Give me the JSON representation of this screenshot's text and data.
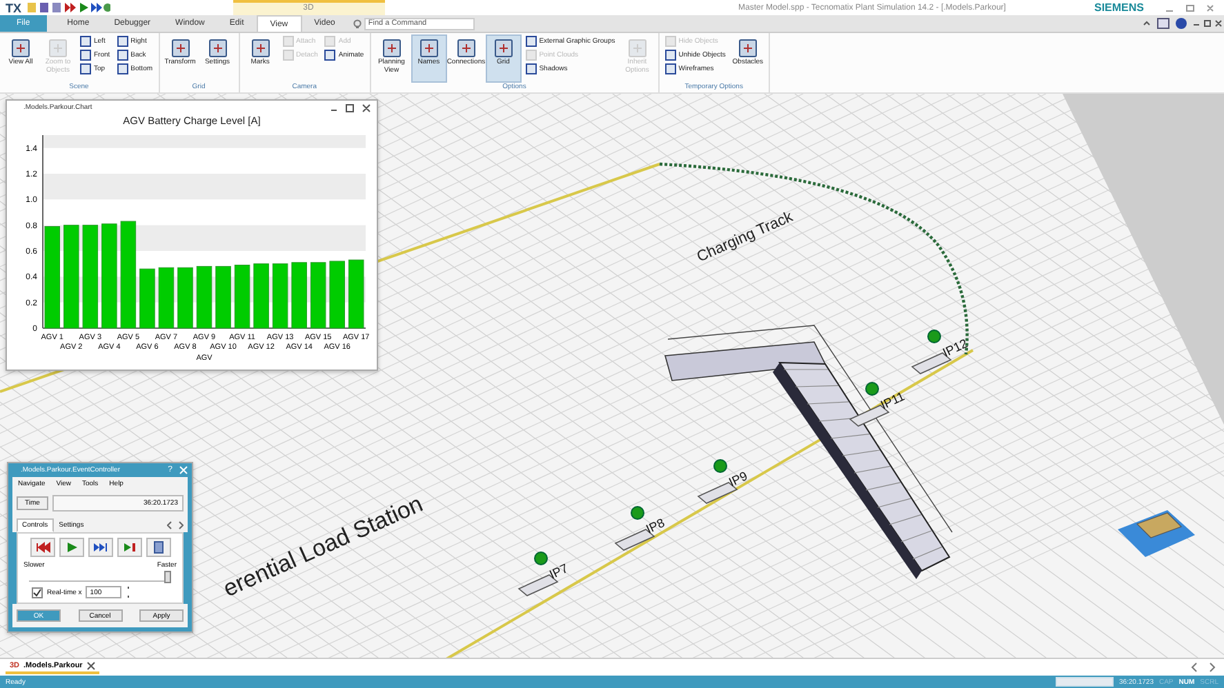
{
  "app": {
    "quick_access": "TX",
    "title": "Master Model.spp - Tecnomatix Plant Simulation 14.2 - [.Models.Parkour]",
    "logo": "SIEMENS",
    "context_tab": "3D"
  },
  "tabs": [
    {
      "label": "File",
      "selected": false,
      "kind": "file"
    },
    {
      "label": "Home",
      "selected": false,
      "kind": "tab"
    },
    {
      "label": "Debugger",
      "selected": false,
      "kind": "tab"
    },
    {
      "label": "Window",
      "selected": false,
      "kind": "tab"
    },
    {
      "label": "Edit",
      "selected": false,
      "kind": "tab"
    },
    {
      "label": "View",
      "selected": true,
      "kind": "tab"
    },
    {
      "label": "Video",
      "selected": false,
      "kind": "tab"
    }
  ],
  "search": {
    "placeholder": "Find a Command"
  },
  "ribbon": [
    {
      "group": "Scene",
      "items": [
        {
          "kind": "large",
          "label": "View All",
          "disabled": false,
          "selected": false
        },
        {
          "kind": "large",
          "label": "Zoom to Objects",
          "disabled": true,
          "selected": false
        },
        {
          "kind": "stack",
          "items": [
            {
              "label": "Left",
              "disabled": false
            },
            {
              "label": "Front",
              "disabled": false
            },
            {
              "label": "Top",
              "disabled": false
            }
          ]
        },
        {
          "kind": "stack",
          "items": [
            {
              "label": "Right",
              "disabled": false
            },
            {
              "label": "Back",
              "disabled": false
            },
            {
              "label": "Bottom",
              "disabled": false
            }
          ]
        }
      ]
    },
    {
      "group": "Grid",
      "items": [
        {
          "kind": "large",
          "label": "Transform",
          "disabled": false,
          "selected": false
        },
        {
          "kind": "large",
          "label": "Settings",
          "disabled": false,
          "selected": false
        }
      ]
    },
    {
      "group": "Camera",
      "items": [
        {
          "kind": "large",
          "label": "Marks",
          "disabled": false,
          "selected": false
        },
        {
          "kind": "stack",
          "items": [
            {
              "label": "Attach",
              "disabled": true
            },
            {
              "label": "Detach",
              "disabled": true
            }
          ]
        },
        {
          "kind": "stack",
          "items": [
            {
              "label": "Add",
              "disabled": true
            },
            {
              "label": "Animate",
              "disabled": false
            }
          ]
        }
      ]
    },
    {
      "group": "Options",
      "items": [
        {
          "kind": "large",
          "label": "Planning View",
          "disabled": false,
          "selected": false
        },
        {
          "kind": "large",
          "label": "Names",
          "disabled": false,
          "selected": true
        },
        {
          "kind": "large",
          "label": "Connections",
          "disabled": false,
          "selected": false
        },
        {
          "kind": "large",
          "label": "Grid",
          "disabled": false,
          "selected": true
        },
        {
          "kind": "stack",
          "items": [
            {
              "label": "External Graphic Groups",
              "disabled": false
            },
            {
              "label": "Point Clouds",
              "disabled": true
            },
            {
              "label": "Shadows",
              "disabled": false
            }
          ]
        },
        {
          "kind": "large",
          "label": "Inherit Options",
          "disabled": true,
          "selected": false
        }
      ]
    },
    {
      "group": "Temporary Options",
      "items": [
        {
          "kind": "stack",
          "items": [
            {
              "label": "Hide Objects",
              "disabled": true
            },
            {
              "label": "Unhide Objects",
              "disabled": false
            },
            {
              "label": "Wireframes",
              "disabled": false
            }
          ]
        },
        {
          "kind": "large",
          "label": "Obstacles",
          "disabled": false,
          "selected": false
        }
      ]
    }
  ],
  "chart_window": {
    "title": ".Models.Parkour.Chart",
    "chart_data": {
      "type": "bar",
      "title": "AGV Battery Charge Level [A]",
      "xlabel": "AGV",
      "categories": [
        "AGV 1",
        "AGV 2",
        "AGV 3",
        "AGV 4",
        "AGV 5",
        "AGV 6",
        "AGV 7",
        "AGV 8",
        "AGV 9",
        "AGV 10",
        "AGV 11",
        "AGV 12",
        "AGV 13",
        "AGV 14",
        "AGV 15",
        "AGV 16",
        "AGV 17"
      ],
      "series": [
        {
          "color": "#00cc00",
          "values": [
            0.79,
            0.8,
            0.8,
            0.81,
            0.83,
            0.46,
            0.47,
            0.47,
            0.48,
            0.48,
            0.49,
            0.5,
            0.5,
            0.51,
            0.51,
            0.52,
            0.53
          ]
        }
      ],
      "ylim": [
        0,
        1.5
      ],
      "yticks": [
        0,
        {
          "value": 0.2,
          "label": "0.2"
        },
        {
          "value": 0.4,
          "label": "0.4"
        },
        {
          "value": 0.6,
          "label": "0.6"
        },
        {
          "value": 0.8,
          "label": "0.8"
        },
        {
          "value": 1,
          "label": "1.0"
        },
        {
          "value": 1.2,
          "label": "1.2"
        },
        {
          "value": 1.4,
          "label": "1.4"
        }
      ]
    }
  },
  "scene": {
    "labels": [
      {
        "text": "Charging Track"
      },
      {
        "text": "erential Load Station"
      }
    ],
    "stations": [
      {
        "label": "IP7"
      },
      {
        "label": "IP8"
      },
      {
        "label": "IP9"
      },
      {
        "label": "IP11"
      },
      {
        "label": "IP12"
      }
    ]
  },
  "event_controller": {
    "title": ".Models.Parkour.EventController",
    "help": "?",
    "menu": [
      "Navigate",
      "View",
      "Tools",
      "Help"
    ],
    "time_button": "Time",
    "time_value": "36:20.1723",
    "tabs": [
      {
        "label": "Controls",
        "selected": true
      },
      {
        "label": "Settings",
        "selected": false
      }
    ],
    "slower": "Slower",
    "faster": "Faster",
    "speed": {
      "level": 0.95
    },
    "realtime": {
      "label": "Real-time x",
      "checked": true,
      "value": "100"
    },
    "buttons": [
      {
        "label": "OK",
        "kind": "primary"
      },
      {
        "label": "Cancel",
        "kind": "normal"
      },
      {
        "label": "Apply",
        "kind": "normal"
      }
    ]
  },
  "documents": [
    {
      "icon_text": "3D",
      "label": ".Models.Parkour",
      "selected": true
    }
  ],
  "status_bar": {
    "text": "Ready",
    "progress": {
      "level": 1
    },
    "time": "36:20.1723",
    "indicators": [
      {
        "label": "CAP",
        "on": false
      },
      {
        "label": "NUM",
        "on": true
      },
      {
        "label": "SCRL",
        "on": false
      }
    ]
  }
}
